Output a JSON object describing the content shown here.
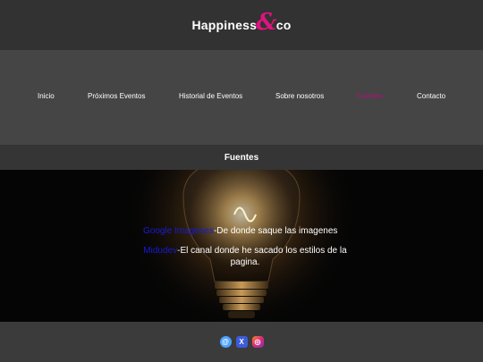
{
  "brand": {
    "left": "Happiness",
    "amp": "&",
    "right": "co"
  },
  "nav": {
    "items": [
      {
        "label": "Inicio"
      },
      {
        "label": "Próximos Eventos"
      },
      {
        "label": "Historial de Eventos"
      },
      {
        "label": "Sobre nosotros"
      },
      {
        "label": "Fuentes"
      },
      {
        "label": "Contacto"
      }
    ],
    "active_color": "#b0117a"
  },
  "section": {
    "title": "Fuentes"
  },
  "sources": [
    {
      "link": "Google Imagenes",
      "text": "-De donde saque las imagenes"
    },
    {
      "link": "Midudev",
      "text": "-El canal donde he sacado los estilos de la pagina."
    }
  ],
  "footer": {
    "icons": [
      "threads-icon",
      "x-icon",
      "instagram-icon"
    ]
  },
  "colors": {
    "accent": "#e0137f",
    "link": "#1a1ad4",
    "bg": "#3a3a3a"
  }
}
